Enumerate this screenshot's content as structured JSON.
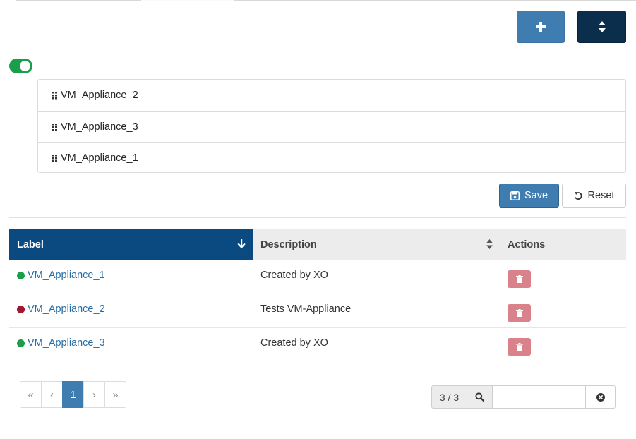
{
  "toolbar": {
    "add_icon": "plus-icon",
    "sort_icon": "sort-icon"
  },
  "toggle": {
    "enabled": true,
    "color": "#1a9e4a"
  },
  "sort_list": {
    "items": [
      {
        "label": "VM_Appliance_2"
      },
      {
        "label": "VM_Appliance_3"
      },
      {
        "label": "VM_Appliance_1"
      }
    ]
  },
  "actions": {
    "save_label": "Save",
    "reset_label": "Reset"
  },
  "table": {
    "headers": {
      "label": "Label",
      "description": "Description",
      "actions": "Actions"
    },
    "rows": [
      {
        "label": "VM_Appliance_1",
        "description": "Created by XO",
        "status_color": "#1a9e4a"
      },
      {
        "label": "VM_Appliance_2",
        "description": "Tests VM-Appliance",
        "status_color": "#a01730"
      },
      {
        "label": "VM_Appliance_3",
        "description": "Created by XO",
        "status_color": "#1a9e4a"
      }
    ]
  },
  "pagination": {
    "first": "«",
    "prev": "‹",
    "current": "1",
    "next": "›",
    "last": "»"
  },
  "filter": {
    "count": "3 / 3",
    "value": "",
    "placeholder": ""
  },
  "colors": {
    "primary": "#3f7cb0",
    "dark": "#0b2e4c",
    "header_active": "#0b4a80",
    "danger_light": "#d9828c"
  }
}
